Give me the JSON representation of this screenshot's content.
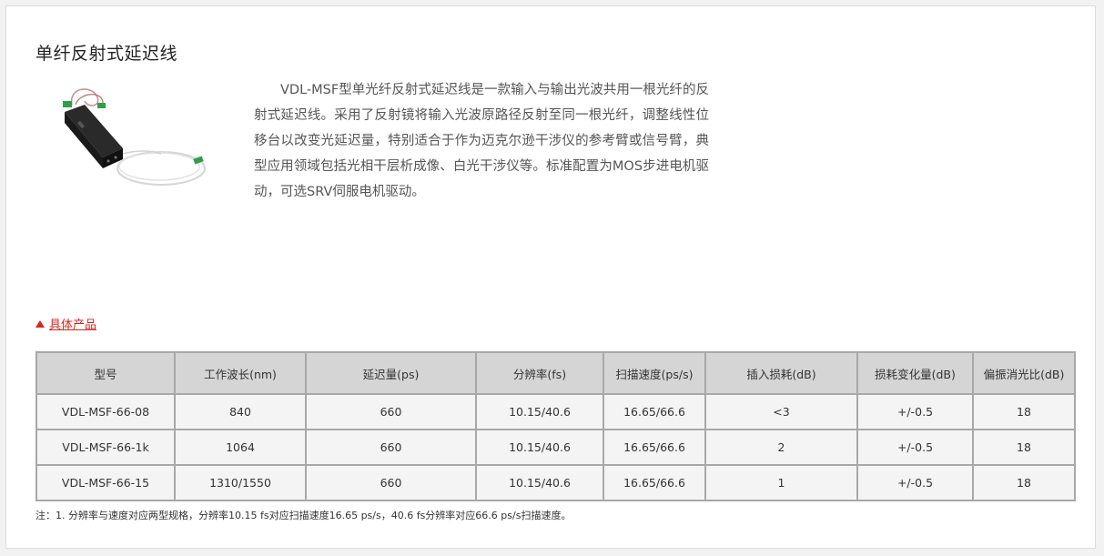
{
  "page": {
    "title": "单纤反射式延迟线",
    "description": "VDL-MSF型单光纤反射式延迟线是一款输入与输出光波共用一根光纤的反射式延迟线。采用了反射镜将输入光波原路径反射至同一根光纤，调整线性位移台以改变光延迟量，特别适合于作为迈克尔逊干涉仪的参考臂或信号臂，典型应用领域包括光相干层析成像、白光干涉仪等。标准配置为MOS步进电机驱动，可选SRV伺服电机驱动。",
    "product_image_icon": "fiber-delay-line-device-icon",
    "section_link": "具体产品",
    "accent_color": "#d9261c"
  },
  "table": {
    "headers": [
      "型号",
      "工作波长(nm)",
      "延迟量(ps)",
      "分辨率(fs)",
      "扫描速度(ps/s)",
      "插入损耗(dB)",
      "损耗变化量(dB)",
      "偏振消光比(dB)"
    ],
    "rows": [
      [
        "VDL-MSF-66-08",
        "840",
        "660",
        "10.15/40.6",
        "16.65/66.6",
        "<3",
        "+/-0.5",
        "18"
      ],
      [
        "VDL-MSF-66-1k",
        "1064",
        "660",
        "10.15/40.6",
        "16.65/66.6",
        "2",
        "+/-0.5",
        "18"
      ],
      [
        "VDL-MSF-66-15",
        "1310/1550",
        "660",
        "10.15/40.6",
        "16.65/66.6",
        "1",
        "+/-0.5",
        "18"
      ]
    ]
  },
  "footnote": "注：1. 分辨率与速度对应两型规格，分辨率10.15 fs对应扫描速度16.65 ps/s，40.6 fs分辨率对应66.6 ps/s扫描速度。"
}
